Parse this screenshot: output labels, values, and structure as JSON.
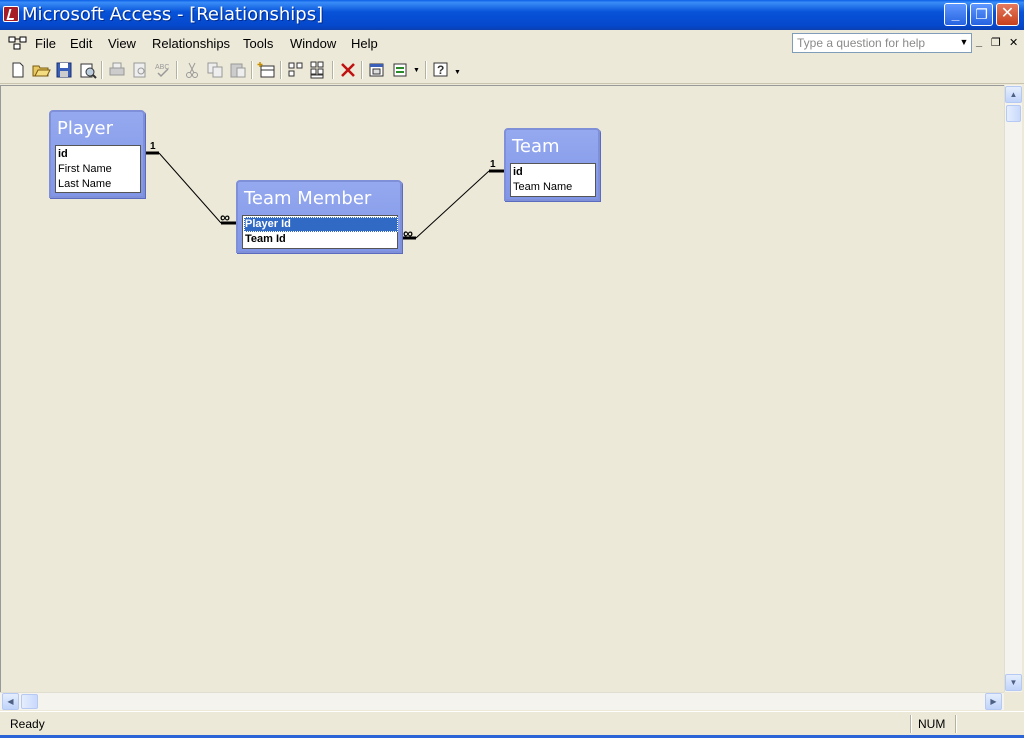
{
  "window": {
    "title": "Microsoft Access - [Relationships]",
    "buttons": {
      "minimize": "_",
      "restore": "❐",
      "close": "✕"
    }
  },
  "menu": {
    "items": [
      "File",
      "Edit",
      "View",
      "Relationships",
      "Tools",
      "Window",
      "Help"
    ],
    "help_placeholder": "Type a question for help",
    "mdi_controls": [
      "_",
      "❐",
      "✕"
    ]
  },
  "toolbar": {
    "icons": [
      "new-icon",
      "open-icon",
      "save-icon",
      "print-preview-icon",
      "print-icon",
      "preview-icon",
      "spelling-icon",
      "cut-icon",
      "copy-icon",
      "paste-icon",
      "show-table-icon",
      "show-direct-icon",
      "show-all-icon",
      "delete-icon",
      "new-object-icon",
      "office-links-icon",
      "help-icon"
    ]
  },
  "tables": {
    "player": {
      "title": "Player",
      "fields": [
        "id",
        "First Name",
        "Last Name"
      ]
    },
    "team_member": {
      "title": "Team Member",
      "fields": [
        "Player Id",
        "Team Id"
      ],
      "selected": "Player Id"
    },
    "team": {
      "title": "Team",
      "fields": [
        "id",
        "Team Name"
      ]
    }
  },
  "relationships": [
    {
      "from": "Player.id",
      "to": "Team Member.Player Id",
      "one": "1",
      "many": "∞"
    },
    {
      "from": "Team.id",
      "to": "Team Member.Team Id",
      "one": "1",
      "many": "∞"
    }
  ],
  "status": {
    "text": "Ready",
    "num": "NUM"
  }
}
